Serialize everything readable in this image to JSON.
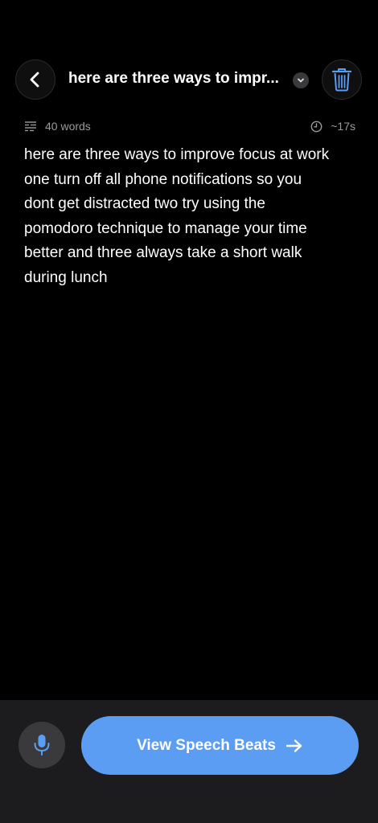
{
  "header": {
    "title": "here are three ways to impr...",
    "back_icon": "chevron-left-icon",
    "dropdown_icon": "chevron-down-icon",
    "delete_icon": "trash-icon"
  },
  "meta": {
    "word_count": "40 words",
    "duration": "~17s",
    "word_count_icon": "text-lines-icon",
    "duration_icon": "clock-icon"
  },
  "transcript": {
    "lines": [
      "here are three ways to improve focus at work",
      "one turn off all phone notifications so you",
      "dont get distracted two try using the",
      "pomodoro technique to manage your time",
      "better and three always take a short walk",
      "during lunch"
    ]
  },
  "footer": {
    "mic_icon": "microphone-icon",
    "primary_label": "View Speech Beats",
    "primary_icon": "arrow-right-icon"
  },
  "colors": {
    "background": "#000000",
    "accent": "#5a9df2",
    "bottom_bar": "#1c1c1e",
    "muted_text": "#9a9a9e"
  }
}
